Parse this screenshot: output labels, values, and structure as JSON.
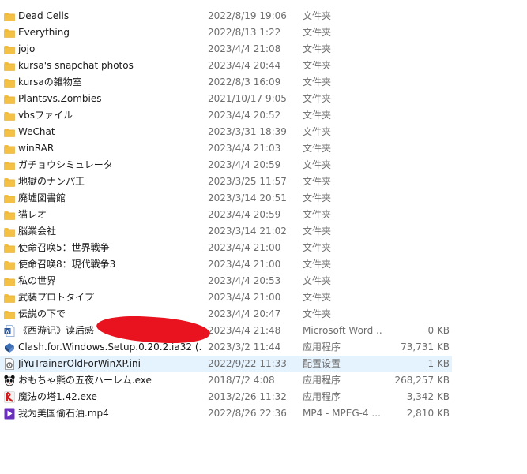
{
  "colors": {
    "folder": "#f4c144",
    "folder_dark": "#e0a82e",
    "selected_row": "#e5f3ff",
    "redaction": "#e8131e",
    "secondary_text": "#6d6d6d"
  },
  "files": [
    {
      "name": "Dead Cells",
      "date": "2022/8/19 19:06",
      "type": "文件夹",
      "size": "",
      "icon": "folder-icon"
    },
    {
      "name": "Everything",
      "date": "2022/8/13 1:22",
      "type": "文件夹",
      "size": "",
      "icon": "folder-icon"
    },
    {
      "name": "jojo",
      "date": "2023/4/4 21:08",
      "type": "文件夹",
      "size": "",
      "icon": "folder-icon"
    },
    {
      "name": "kursa's snapchat photos",
      "date": "2023/4/4 20:44",
      "type": "文件夹",
      "size": "",
      "icon": "folder-icon"
    },
    {
      "name": "kursaの雑物室",
      "date": "2022/8/3 16:09",
      "type": "文件夹",
      "size": "",
      "icon": "folder-icon"
    },
    {
      "name": "Plantsvs.Zombies",
      "date": "2021/10/17 9:05",
      "type": "文件夹",
      "size": "",
      "icon": "folder-icon"
    },
    {
      "name": "vbsファイル",
      "date": "2023/4/4 20:52",
      "type": "文件夹",
      "size": "",
      "icon": "folder-icon"
    },
    {
      "name": "WeChat",
      "date": "2023/3/31 18:39",
      "type": "文件夹",
      "size": "",
      "icon": "folder-icon"
    },
    {
      "name": "winRAR",
      "date": "2023/4/4 21:03",
      "type": "文件夹",
      "size": "",
      "icon": "folder-icon"
    },
    {
      "name": "ガチョウシミュレータ",
      "date": "2023/4/4 20:59",
      "type": "文件夹",
      "size": "",
      "icon": "folder-icon"
    },
    {
      "name": "地獄のナンパ王",
      "date": "2023/3/25 11:57",
      "type": "文件夹",
      "size": "",
      "icon": "folder-icon"
    },
    {
      "name": "廃墟図書館",
      "date": "2023/3/14 20:51",
      "type": "文件夹",
      "size": "",
      "icon": "folder-icon"
    },
    {
      "name": "猫レオ",
      "date": "2023/4/4 20:59",
      "type": "文件夹",
      "size": "",
      "icon": "folder-icon"
    },
    {
      "name": "脳業会社",
      "date": "2023/3/14 21:02",
      "type": "文件夹",
      "size": "",
      "icon": "folder-icon"
    },
    {
      "name": "使命召唤5：世界戦争",
      "date": "2023/4/4 21:00",
      "type": "文件夹",
      "size": "",
      "icon": "folder-icon"
    },
    {
      "name": "使命召唤8：現代戦争3",
      "date": "2023/4/4 21:00",
      "type": "文件夹",
      "size": "",
      "icon": "folder-icon"
    },
    {
      "name": "私の世界",
      "date": "2023/4/4 20:53",
      "type": "文件夹",
      "size": "",
      "icon": "folder-icon"
    },
    {
      "name": "武装プロトタイプ",
      "date": "2023/4/4 21:00",
      "type": "文件夹",
      "size": "",
      "icon": "folder-icon"
    },
    {
      "name": "伝説の下で",
      "date": "2023/4/4 20:47",
      "type": "文件夹",
      "size": "",
      "icon": "folder-icon"
    },
    {
      "name": "《西游记》读后感",
      "date": "2023/4/4 21:48",
      "type": "Microsoft Word ...",
      "size": "0 KB",
      "icon": "word-document-icon"
    },
    {
      "name": "Clash.for.Windows.Setup.0.20.2.ia32 (...",
      "date": "2023/3/2 11:44",
      "type": "应用程序",
      "size": "73,731 KB",
      "icon": "setup-installer-icon"
    },
    {
      "name": "JiYuTrainerOldForWinXP.ini",
      "date": "2022/9/22 11:33",
      "type": "配置设置",
      "size": "1 KB",
      "icon": "config-file-icon",
      "selected": true
    },
    {
      "name": "おもちゃ熊の五夜ハーレム.exe",
      "date": "2018/7/2 4:08",
      "type": "应用程序",
      "size": "268,257 KB",
      "icon": "panda-app-icon"
    },
    {
      "name": "魔法の塔1.42.exe",
      "date": "2013/2/26 11:32",
      "type": "应用程序",
      "size": "3,342 KB",
      "icon": "magic-tower-app-icon"
    },
    {
      "name": "我为美国偷石油.mp4",
      "date": "2022/8/26 22:36",
      "type": "MP4 - MPEG-4 ...",
      "size": "2,810 KB",
      "icon": "video-file-icon"
    }
  ]
}
